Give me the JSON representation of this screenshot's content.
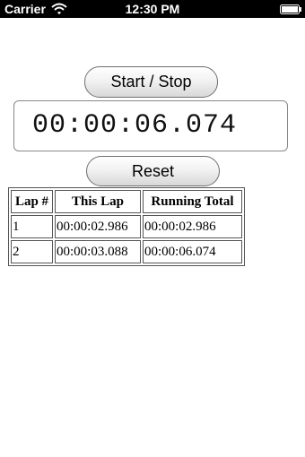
{
  "status_bar": {
    "carrier": "Carrier",
    "time": "12:30 PM",
    "wifi_icon": "wifi-icon",
    "battery_icon": "battery-icon",
    "background": "#000000",
    "text_color": "#ffffff"
  },
  "controls": {
    "start_stop_label": "Start / Stop",
    "reset_label": "Reset"
  },
  "timer": {
    "display": "00:00:06.074"
  },
  "lap_table": {
    "headers": {
      "lap": "Lap #",
      "this_lap": "This Lap",
      "running_total": "Running Total"
    },
    "rows": [
      {
        "lap": "1",
        "this_lap": "00:00:02.986",
        "running_total": "00:00:02.986"
      },
      {
        "lap": "2",
        "this_lap": "00:00:03.088",
        "running_total": "00:00:06.074"
      }
    ]
  }
}
